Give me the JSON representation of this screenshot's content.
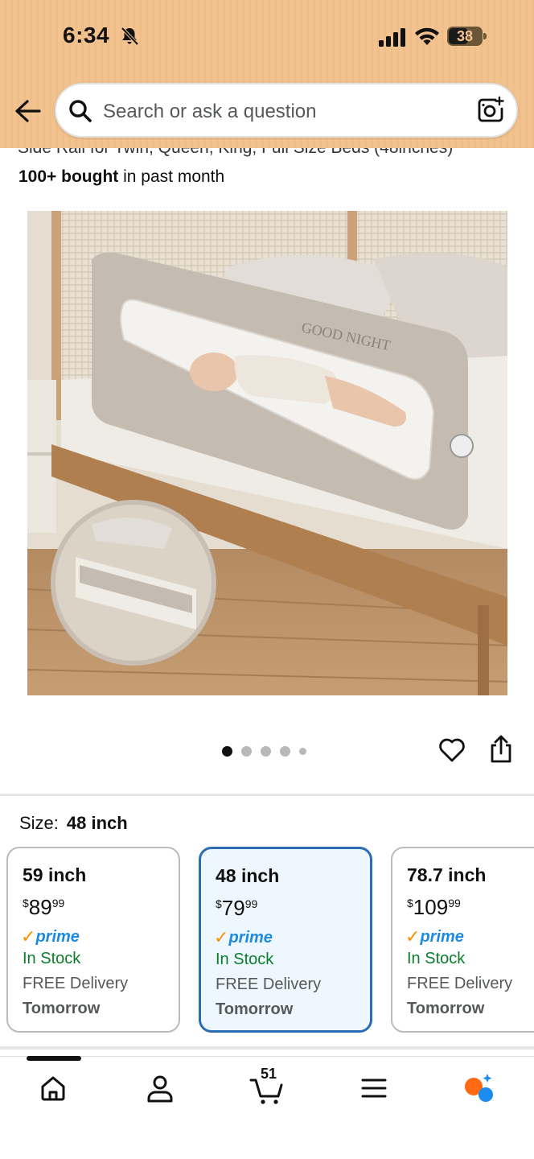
{
  "status_bar": {
    "time": "6:34",
    "battery": "38"
  },
  "search": {
    "placeholder": "Search or ask a question"
  },
  "product": {
    "title_partial": "Side Rail for Twin, Queen, King, Full Size Beds (48inches)",
    "bought_count": "100+ bought",
    "bought_suffix": " in past month",
    "image_text": "GOOD NIGHT",
    "carousel_total": 5,
    "carousel_active": 1
  },
  "size_selector": {
    "label": "Size:",
    "selected": "48 inch",
    "options": [
      {
        "name": "59 inch",
        "price_currency": "$",
        "price_whole": "89",
        "price_fraction": "99",
        "prime": "prime",
        "availability": "In Stock",
        "delivery": "FREE Delivery",
        "delivery_day": "Tomorrow"
      },
      {
        "name": "48 inch",
        "price_currency": "$",
        "price_whole": "79",
        "price_fraction": "99",
        "prime": "prime",
        "availability": "In Stock",
        "delivery": "FREE Delivery",
        "delivery_day": "Tomorrow"
      },
      {
        "name": "78.7 inch",
        "price_currency": "$",
        "price_whole": "109",
        "price_fraction": "99",
        "prime": "prime",
        "availability": "In Stock",
        "delivery": "FREE Delivery",
        "delivery_day": "Tomorrow"
      }
    ]
  },
  "bottom_nav": {
    "cart_count": "51"
  },
  "colors": {
    "header_bg": "#f3c38f",
    "selected_border": "#2a6db2",
    "selected_bg": "#edf7fd",
    "in_stock": "#0a7e2a",
    "prime_blue": "#1b8ae0",
    "prime_check": "#ff8f00"
  }
}
